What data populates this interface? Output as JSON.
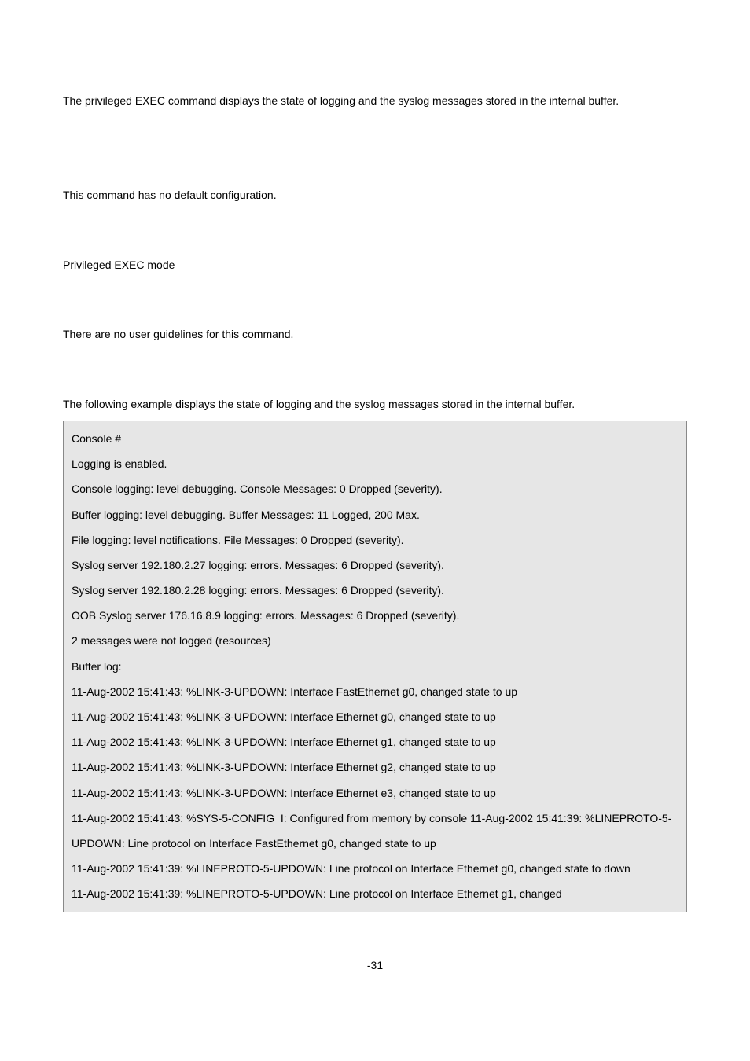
{
  "intro": {
    "p1_a": "The ",
    "p1_b": " privileged EXEC command displays the state of logging and the syslog messages stored in the internal buffer."
  },
  "default_cfg": "This command has no default configuration.",
  "mode": "Privileged EXEC mode",
  "guidelines": "There are no user guidelines for this command.",
  "example_intro": "The following example displays the state of logging and the syslog messages stored in the internal buffer.",
  "console_lines": [
    "Console #",
    "Logging is enabled.",
    "Console logging: level debugging. Console Messages: 0 Dropped (severity).",
    "Buffer logging: level debugging. Buffer Messages: 11 Logged, 200 Max.",
    "File logging: level notifications. File Messages: 0 Dropped (severity).",
    "Syslog server 192.180.2.27 logging: errors. Messages: 6 Dropped (severity).",
    "Syslog server 192.180.2.28 logging: errors. Messages: 6 Dropped (severity).",
    "OOB Syslog server 176.16.8.9 logging: errors. Messages: 6 Dropped (severity).",
    "2 messages were not logged (resources)",
    "Buffer log:",
    "11-Aug-2002 15:41:43: %LINK-3-UPDOWN: Interface FastEthernet g0, changed state to up",
    "11-Aug-2002 15:41:43: %LINK-3-UPDOWN: Interface Ethernet g0, changed state to up",
    "11-Aug-2002 15:41:43: %LINK-3-UPDOWN: Interface Ethernet g1, changed state to up",
    "11-Aug-2002 15:41:43: %LINK-3-UPDOWN: Interface Ethernet g2, changed state to up",
    "11-Aug-2002 15:41:43: %LINK-3-UPDOWN: Interface Ethernet e3, changed state to up",
    "11-Aug-2002 15:41:43: %SYS-5-CONFIG_I: Configured from memory by console 11-Aug-2002 15:41:39: %LINEPROTO-5-UPDOWN: Line protocol on Interface FastEthernet g0, changed state to up",
    "11-Aug-2002 15:41:39: %LINEPROTO-5-UPDOWN: Line protocol on Interface Ethernet g0, changed state to down",
    "11-Aug-2002 15:41:39: %LINEPROTO-5-UPDOWN: Line protocol on Interface Ethernet g1, changed"
  ],
  "page_number": "-31"
}
